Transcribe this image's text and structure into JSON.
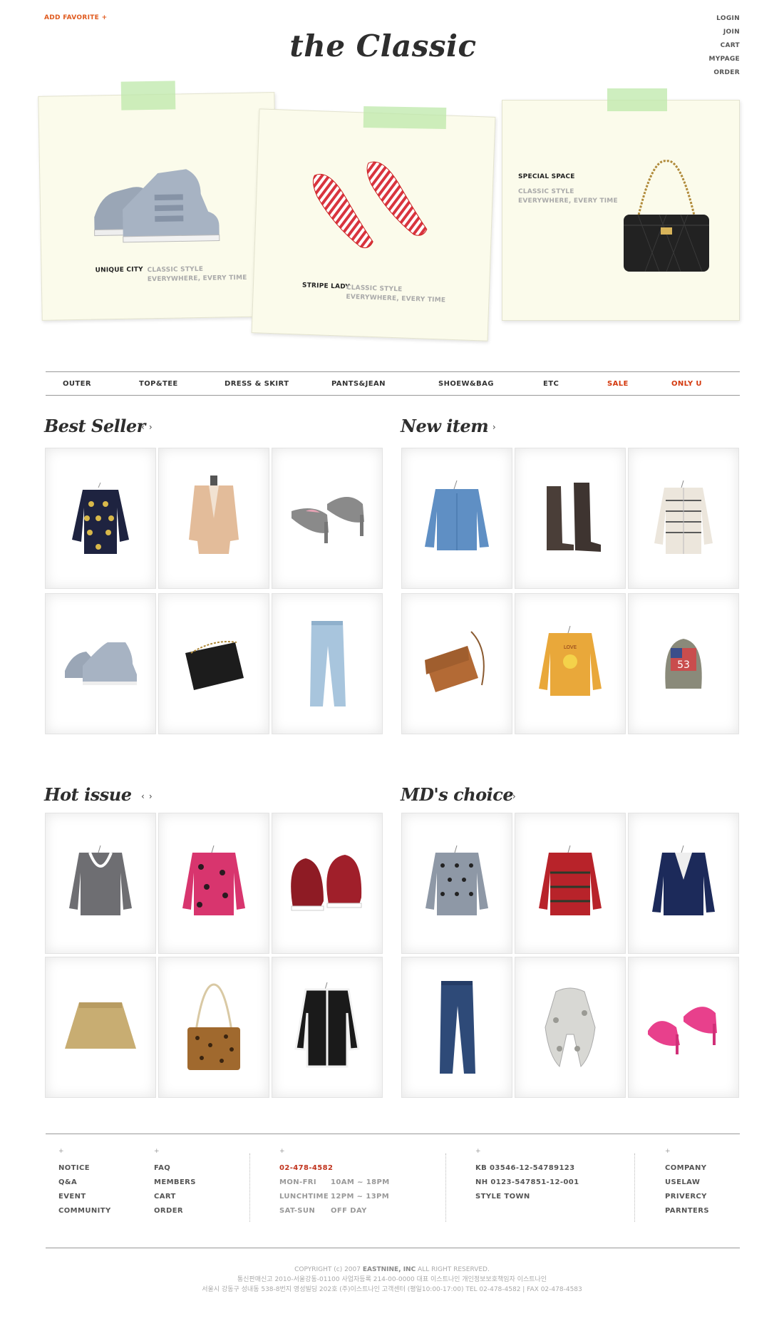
{
  "header": {
    "add_favorite": "ADD FAVORITE +",
    "logo": "the Classic",
    "nav": [
      "LOGIN",
      "JOIN",
      "CART",
      "MYPAGE",
      "ORDER"
    ]
  },
  "hero": [
    {
      "title": "UNIQUE CITY",
      "sub1": "CLASSIC STYLE",
      "sub2": "EVERYWHERE, EVERY TIME",
      "icon": "sneaker-icon"
    },
    {
      "title": "STRIPE LADY",
      "sub1": "CLASSIC STYLE",
      "sub2": "EVERYWHERE, EVERY TIME",
      "icon": "flats-icon"
    },
    {
      "title": "SPECIAL SPACE",
      "sub1": "CLASSIC STYLE",
      "sub2": "EVERYWHERE, EVERY TIME",
      "icon": "handbag-icon"
    }
  ],
  "categories": [
    "OUTER",
    "TOP&TEE",
    "DRESS & SKIRT",
    "PANTS&JEAN",
    "SHOEW&BAG",
    "ETC",
    "SALE",
    "ONLY U"
  ],
  "sections": {
    "best_seller": {
      "title": "Best Seller",
      "prev": "‹",
      "next": "›"
    },
    "new_item": {
      "title": "New item",
      "prev": "‹",
      "next": "›"
    },
    "hot_issue": {
      "title": "Hot issue",
      "prev": "‹",
      "next": "›"
    },
    "md_choice": {
      "title": "MD's choice",
      "prev": "‹",
      "next": "›"
    }
  },
  "products": {
    "best_seller": [
      "bow-sweater-icon",
      "beige-jacket-icon",
      "grey-heels-icon",
      "grey-sneaker-icon",
      "black-clutch-icon",
      "light-jeans-icon"
    ],
    "new_item": [
      "denim-jacket-icon",
      "brown-boots-icon",
      "striped-cardigan-icon",
      "brown-crossbody-icon",
      "yellow-sweatshirt-icon",
      "cap-icon"
    ],
    "hot_issue": [
      "grey-cardigan-icon",
      "pink-leopard-cardigan-icon",
      "red-sneakers-icon",
      "khaki-skirt-icon",
      "leopard-bag-icon",
      "black-white-jacket-icon"
    ],
    "md_choice": [
      "dot-sweater-icon",
      "red-knit-icon",
      "navy-jacket-icon",
      "dark-jeans-icon",
      "fur-scarf-icon",
      "pink-pumps-icon"
    ]
  },
  "colors": {
    "accent": "#e05a1e",
    "sale": "#d4380d",
    "note": "#fbfbeb",
    "tape": "#bee8aa"
  },
  "footer": {
    "col1": [
      "NOTICE",
      "Q&A",
      "EVENT",
      "COMMUNITY"
    ],
    "col2": [
      "FAQ",
      "MEMBERS",
      "CART",
      "ORDER"
    ],
    "phone": "02-478-4582",
    "hours": [
      {
        "label": "MON-FRI",
        "value": "10AM ~ 18PM"
      },
      {
        "label": "LUNCHTIME",
        "value": "12PM ~ 13PM"
      },
      {
        "label": "SAT-SUN",
        "value": "OFF DAY"
      }
    ],
    "bank": [
      "KB 03546-12-54789123",
      "NH 0123-547851-12-001",
      "STYLE TOWN"
    ],
    "col5": [
      "COMPANY",
      "USELAW",
      "PRIVERCY",
      "PARNTERS"
    ],
    "plus": "+",
    "copyright_prefix": "COPYRIGHT (c) 2007 ",
    "copyright_brand": "EASTNINE, INC",
    "copyright_suffix": " ALL RIGHT RESERVED.",
    "line2": "통신판매신고 2010-서울강동-01100        사업자등록 214-00-0000    대표 이스트나인    개인정보보호책임자 이스트나인",
    "line3": "서울시 강동구 성내동 538-8번지 영성빌딩 202호 (주)이스트나인  고객센터 (평일10:00-17:00)   TEL 02-478-4582   |   FAX 02-478-4583"
  }
}
